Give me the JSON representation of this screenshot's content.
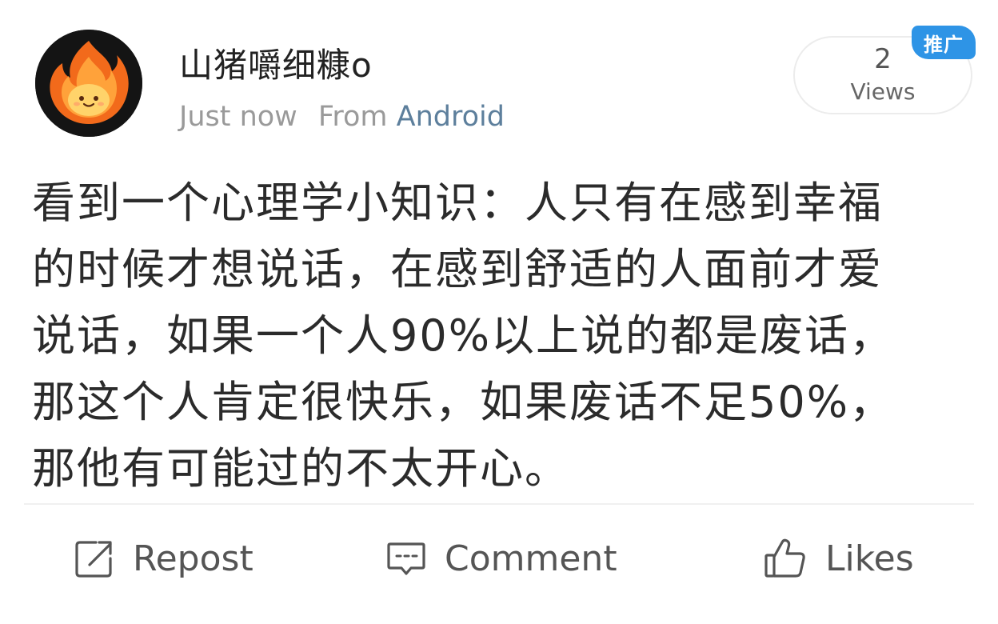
{
  "post": {
    "username": "山猪嚼细糠o",
    "time": "Just now",
    "source_prefix": "From",
    "source_app": "Android",
    "views_count": "2",
    "views_label": "Views",
    "promo_badge": "推广",
    "text_lines": [
      "看到一个心理学小知识：人只有在感到幸福",
      "的时候才想说话，在感到舒适的人面前才爱",
      "说话，如果一个人90%以上说的都是废话，",
      "那这个人肯定很快乐，如果废话不足50%，",
      "那他有可能过的不太开心。"
    ]
  },
  "actions": {
    "repost_label": "Repost",
    "comment_label": "Comment",
    "like_label": "Likes"
  },
  "icons": {
    "avatar": "fire-emoji-avatar",
    "repost": "repost-icon",
    "comment": "comment-icon",
    "like": "thumbs-up-icon"
  },
  "colors": {
    "source_link": "#5d7f9c",
    "promo_badge": "#2e94e6",
    "muted_text": "#9a9a9a"
  }
}
